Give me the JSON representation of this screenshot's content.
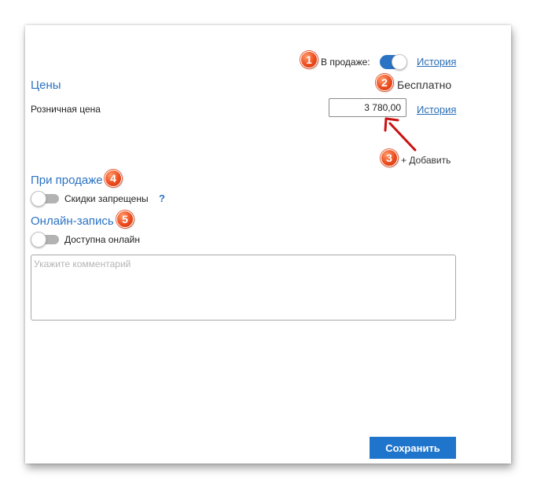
{
  "header": {
    "on_sale_label": "В продаже:",
    "on_sale_enabled": true,
    "history_link": "История"
  },
  "prices": {
    "title": "Цены",
    "free_label": "Бесплатно",
    "retail_label": "Розничная цена",
    "retail_value": "3 780,00",
    "history_link": "История",
    "add_label": "+ Добавить"
  },
  "on_sale_section": {
    "title": "При продаже",
    "discounts_label": "Скидки запрещены",
    "discounts_enabled": false,
    "help": "?"
  },
  "online_section": {
    "title": "Онлайн-запись",
    "available_label": "Доступна онлайн",
    "available_enabled": false,
    "comment_placeholder": "Укажите комментарий",
    "comment_value": ""
  },
  "footer": {
    "save_label": "Сохранить"
  },
  "badges": [
    "1",
    "2",
    "3",
    "4",
    "5"
  ],
  "colors": {
    "accent": "#2b73c3",
    "badge": "#ee4b1d",
    "arrow": "#cc1111",
    "button": "#1f74cc"
  }
}
